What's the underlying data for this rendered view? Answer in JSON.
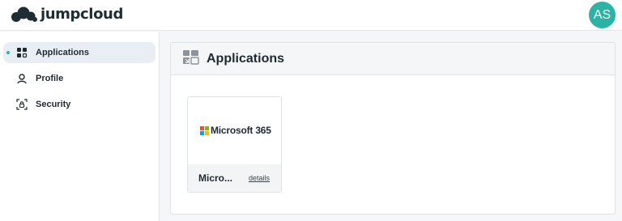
{
  "brand": {
    "name": "jumpcloud",
    "color": "#1e2c33"
  },
  "user": {
    "initials": "AS",
    "avatar_color": "#29b4a6"
  },
  "sidebar": {
    "items": [
      {
        "label": "Applications",
        "icon": "apps-grid-icon",
        "active": true
      },
      {
        "label": "Profile",
        "icon": "person-icon",
        "active": false
      },
      {
        "label": "Security",
        "icon": "lock-scan-icon",
        "active": false
      }
    ]
  },
  "main": {
    "title": "Applications",
    "icon": "applications-icon",
    "apps": [
      {
        "logo_text": "Microsoft 365",
        "name": "Micro...",
        "details_label": "details"
      }
    ]
  },
  "colors": {
    "accent": "#29b4a6",
    "active_bg": "#e8eef3",
    "page_bg": "#f5f6f7"
  }
}
